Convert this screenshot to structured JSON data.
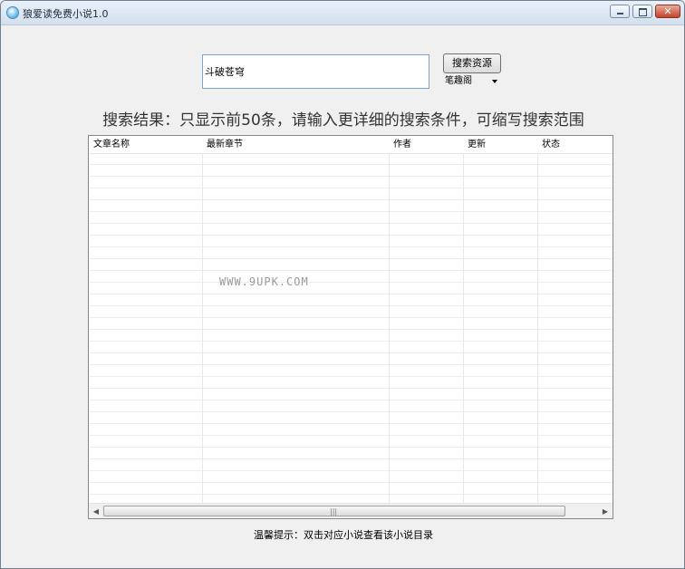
{
  "window": {
    "title": "狼爱读免费小说1.0",
    "close_glyph": "✕"
  },
  "search": {
    "query_value": "斗破苍穹",
    "button_label": "搜索资源",
    "source_selected": "笔趣阁"
  },
  "notice": "搜索结果：只显示前50条，请输入更详细的搜索条件，可缩写搜索范围",
  "table": {
    "columns": [
      "文章名称",
      "最新章节",
      "作者",
      "更新",
      "状态"
    ],
    "rows": [],
    "watermark": "WWW.9UPK.COM"
  },
  "scrollbar": {
    "left_arrow": "◀",
    "right_arrow": "▶",
    "grip": "|||"
  },
  "hint": "温馨提示：双击对应小说查看该小说目录",
  "icons": {
    "app": "app-icon",
    "minimize": "minimize-icon",
    "maximize": "maximize-icon",
    "close": "close-icon",
    "dropdown": "chevron-down-icon"
  }
}
